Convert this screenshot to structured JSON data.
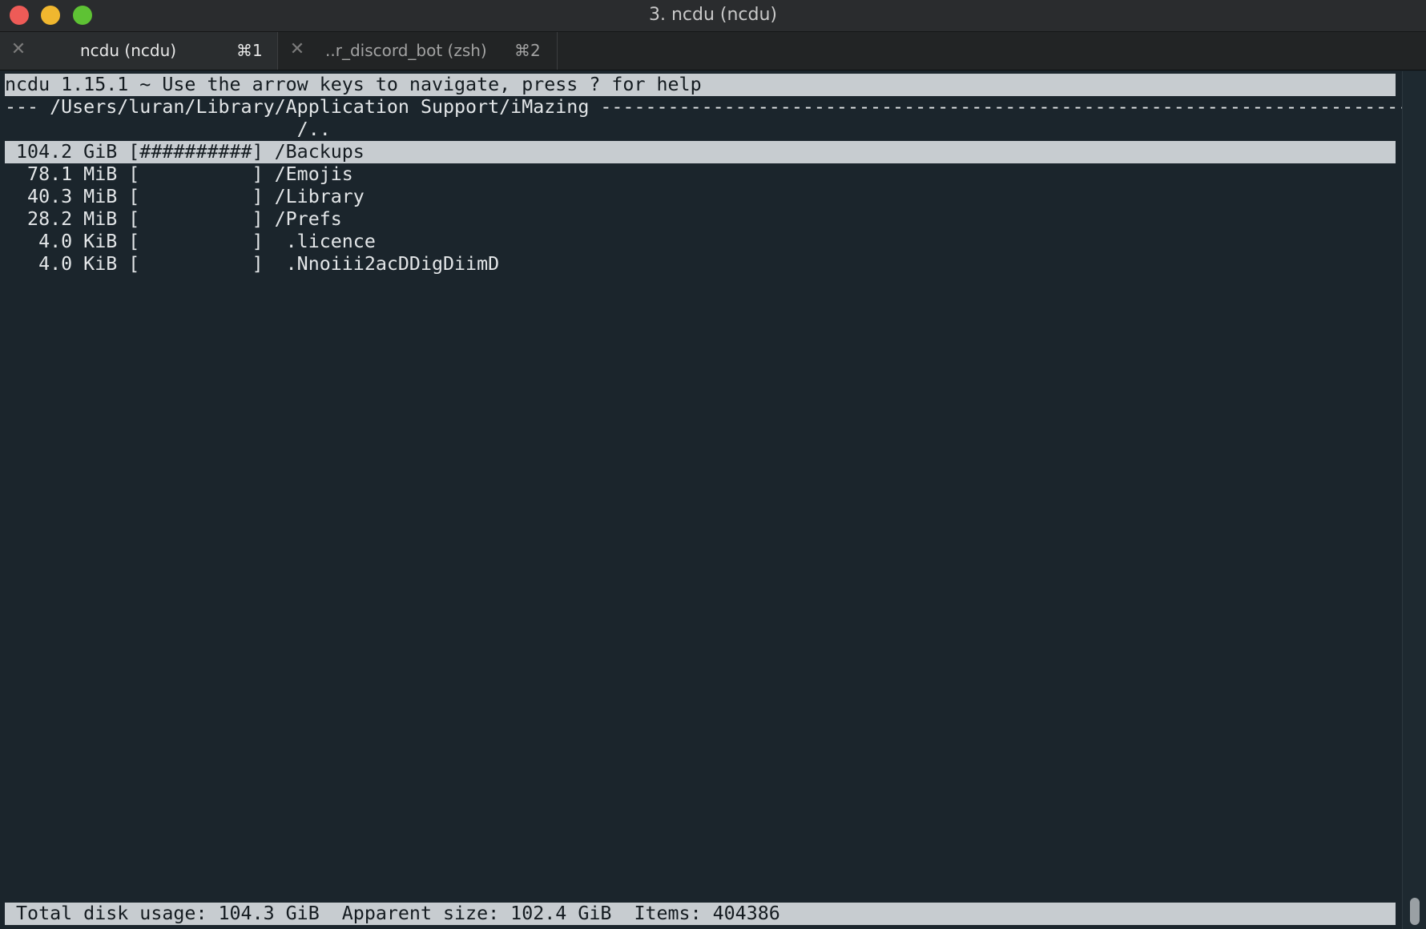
{
  "window": {
    "title": "3. ncdu (ncdu)"
  },
  "tabs": [
    {
      "close_glyph": "✕",
      "label": "ncdu (ncdu)",
      "shortcut": "⌘1",
      "active": true
    },
    {
      "close_glyph": "✕",
      "label": "..r_discord_bot (zsh)",
      "shortcut": "⌘2",
      "active": false
    }
  ],
  "terminal": {
    "header": "ncdu 1.15.1 ~ Use the arrow keys to navigate, press ? for help",
    "path_line": "--- /Users/luran/Library/Application Support/iMazing -------------------------------------------------------------------------",
    "parent_line": "                          /..",
    "entries": [
      {
        "text": " 104.2 GiB [##########] /Backups",
        "size": "104.2 GiB",
        "bar": "##########",
        "name": "/Backups",
        "selected": true
      },
      {
        "text": "  78.1 MiB [          ] /Emojis",
        "size": "78.1 MiB",
        "bar": "",
        "name": "/Emojis",
        "selected": false
      },
      {
        "text": "  40.3 MiB [          ] /Library",
        "size": "40.3 MiB",
        "bar": "",
        "name": "/Library",
        "selected": false
      },
      {
        "text": "  28.2 MiB [          ] /Prefs",
        "size": "28.2 MiB",
        "bar": "",
        "name": "/Prefs",
        "selected": false
      },
      {
        "text": "   4.0 KiB [          ]  .licence",
        "size": "4.0 KiB",
        "bar": "",
        "name": ".licence",
        "selected": false
      },
      {
        "text": "   4.0 KiB [          ]  .Nnoiii2acDDigDiimD",
        "size": "4.0 KiB",
        "bar": "",
        "name": ".Nnoiii2acDDigDiimD",
        "selected": false
      }
    ],
    "status_line": " Total disk usage: 104.3 GiB  Apparent size: 102.4 GiB  Items: 404386"
  },
  "colors": {
    "background": "#1b252c",
    "highlight": "#c7ccd0",
    "text": "#e3e6e8"
  }
}
